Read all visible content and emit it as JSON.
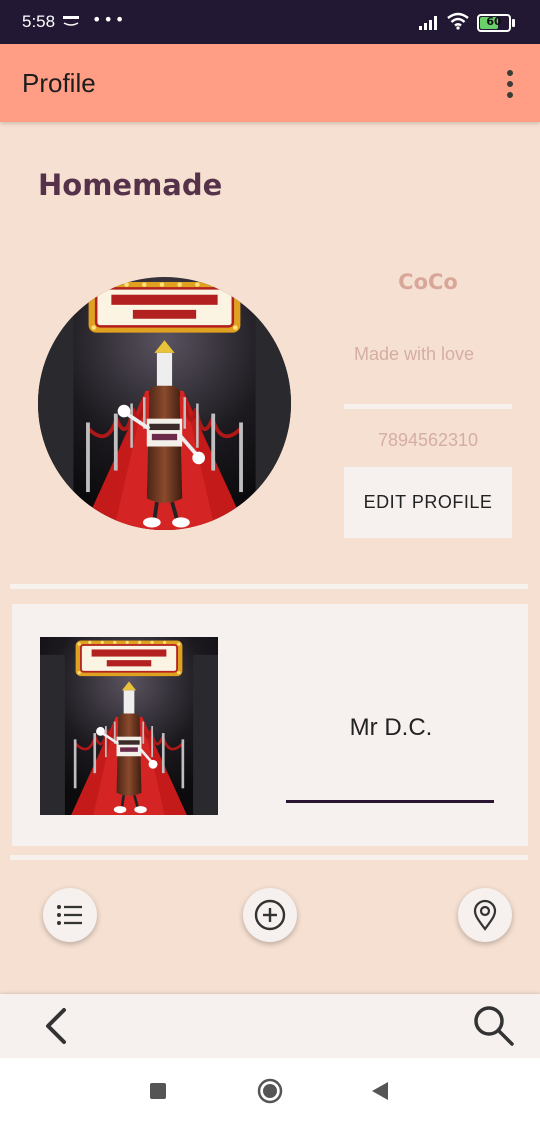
{
  "status_bar": {
    "time": "5:58",
    "notification_icon": "amazon-icon",
    "more_dots": "•••",
    "battery": "60"
  },
  "app_bar": {
    "title": "Profile",
    "menu_icon": "more-vert-icon"
  },
  "page": {
    "heading": "Homemade"
  },
  "profile": {
    "name": "CoCo",
    "bio": "Made with love",
    "phone": "7894562310",
    "edit_label": "EDIT PROFILE",
    "image": "mr-dc-bottle-poster"
  },
  "list": {
    "items": [
      {
        "title": "Mr D.C.",
        "image": "mr-dc-bottle-poster"
      }
    ]
  },
  "fabs": {
    "left": "list-icon",
    "center": "add-circle-icon",
    "right": "location-pin-icon"
  },
  "bottom_bar": {
    "left": "back-chevron-icon",
    "right": "search-icon"
  },
  "colors": {
    "status_bar": "#221833",
    "app_bar": "#ff9e85",
    "background": "#f6e0d1",
    "heading": "#56324a",
    "profile_text": "#d8a79a",
    "card": "#f6f0ee"
  }
}
